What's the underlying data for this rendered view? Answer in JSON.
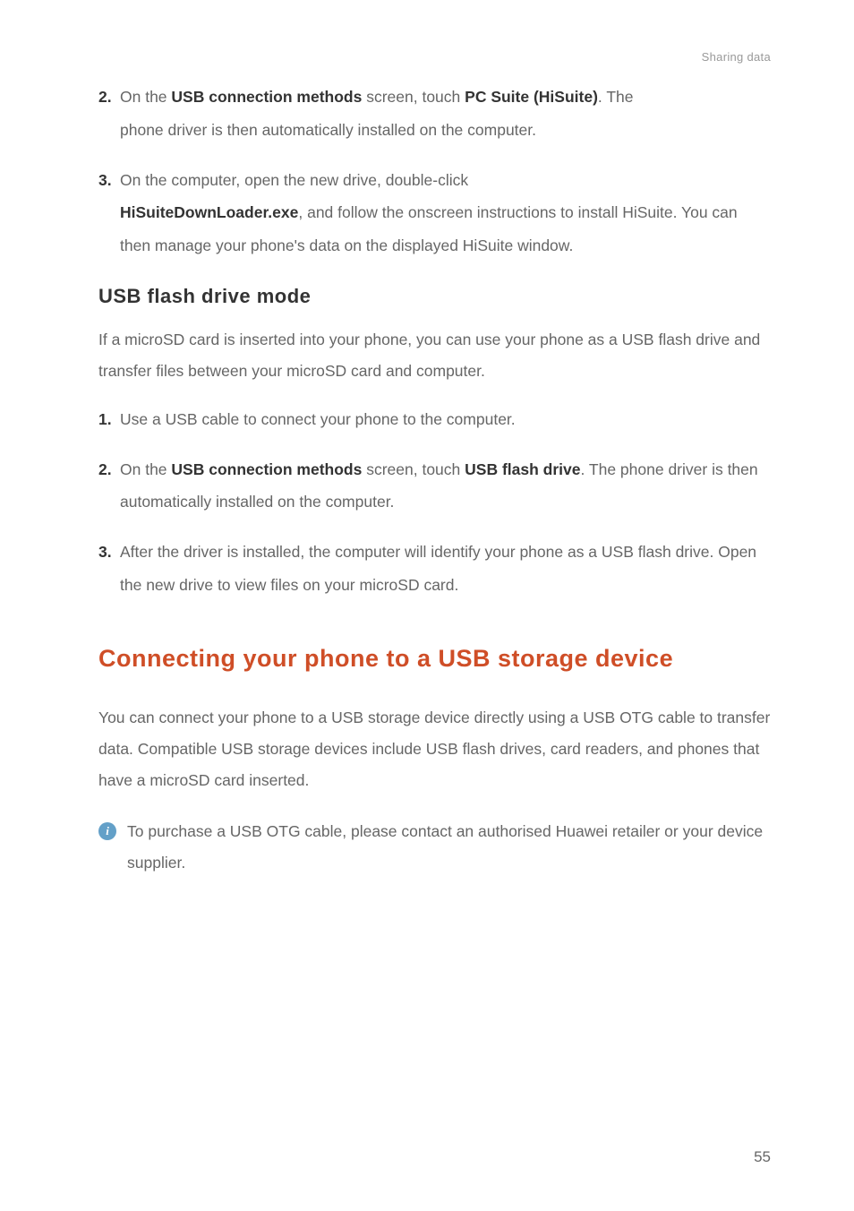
{
  "header": {
    "section_title": "Sharing data"
  },
  "steps_a": [
    {
      "num": "2.",
      "prefix": "On the ",
      "bold1": "USB connection methods",
      "mid": " screen, touch ",
      "bold2": "PC Suite (HiSuite)",
      "suffix": ". The",
      "continuation": "phone driver is then automatically installed on the computer."
    }
  ],
  "step3a": {
    "num": "3.",
    "line1": "On the computer, open the new drive, double-click",
    "bold": "HiSuiteDownLoader.exe",
    "line2_after_bold": ", and follow the onscreen instructions to install HiSuite. You can then manage your phone's data on the displayed HiSuite window."
  },
  "section_usb_flash": {
    "heading": "USB  flash  drive  mode",
    "intro": "If a microSD card is inserted into your phone, you can use your phone as a USB flash drive and transfer files between your microSD card and computer."
  },
  "steps_b": {
    "s1": {
      "num": "1.",
      "text": "Use a USB cable to connect your phone to the computer."
    },
    "s2": {
      "num": "2.",
      "prefix": "On the ",
      "bold1": "USB connection methods",
      "mid": " screen, touch ",
      "bold2": "USB flash drive",
      "suffix": ". The phone driver is then automatically installed on the computer."
    },
    "s3": {
      "num": "3.",
      "text": "After the driver is installed, the computer will identify your phone as a USB flash drive. Open the new drive to view files on your microSD card."
    }
  },
  "main_section": {
    "heading": "Connecting your phone to a USB storage device",
    "para": "You can connect your phone to a USB storage device directly using a USB OTG cable to transfer data. Compatible USB storage devices include USB flash drives, card readers, and phones that have a microSD card inserted."
  },
  "info": {
    "text": "To purchase a USB OTG cable, please contact an authorised Huawei retailer or your device supplier."
  },
  "page_number": "55"
}
